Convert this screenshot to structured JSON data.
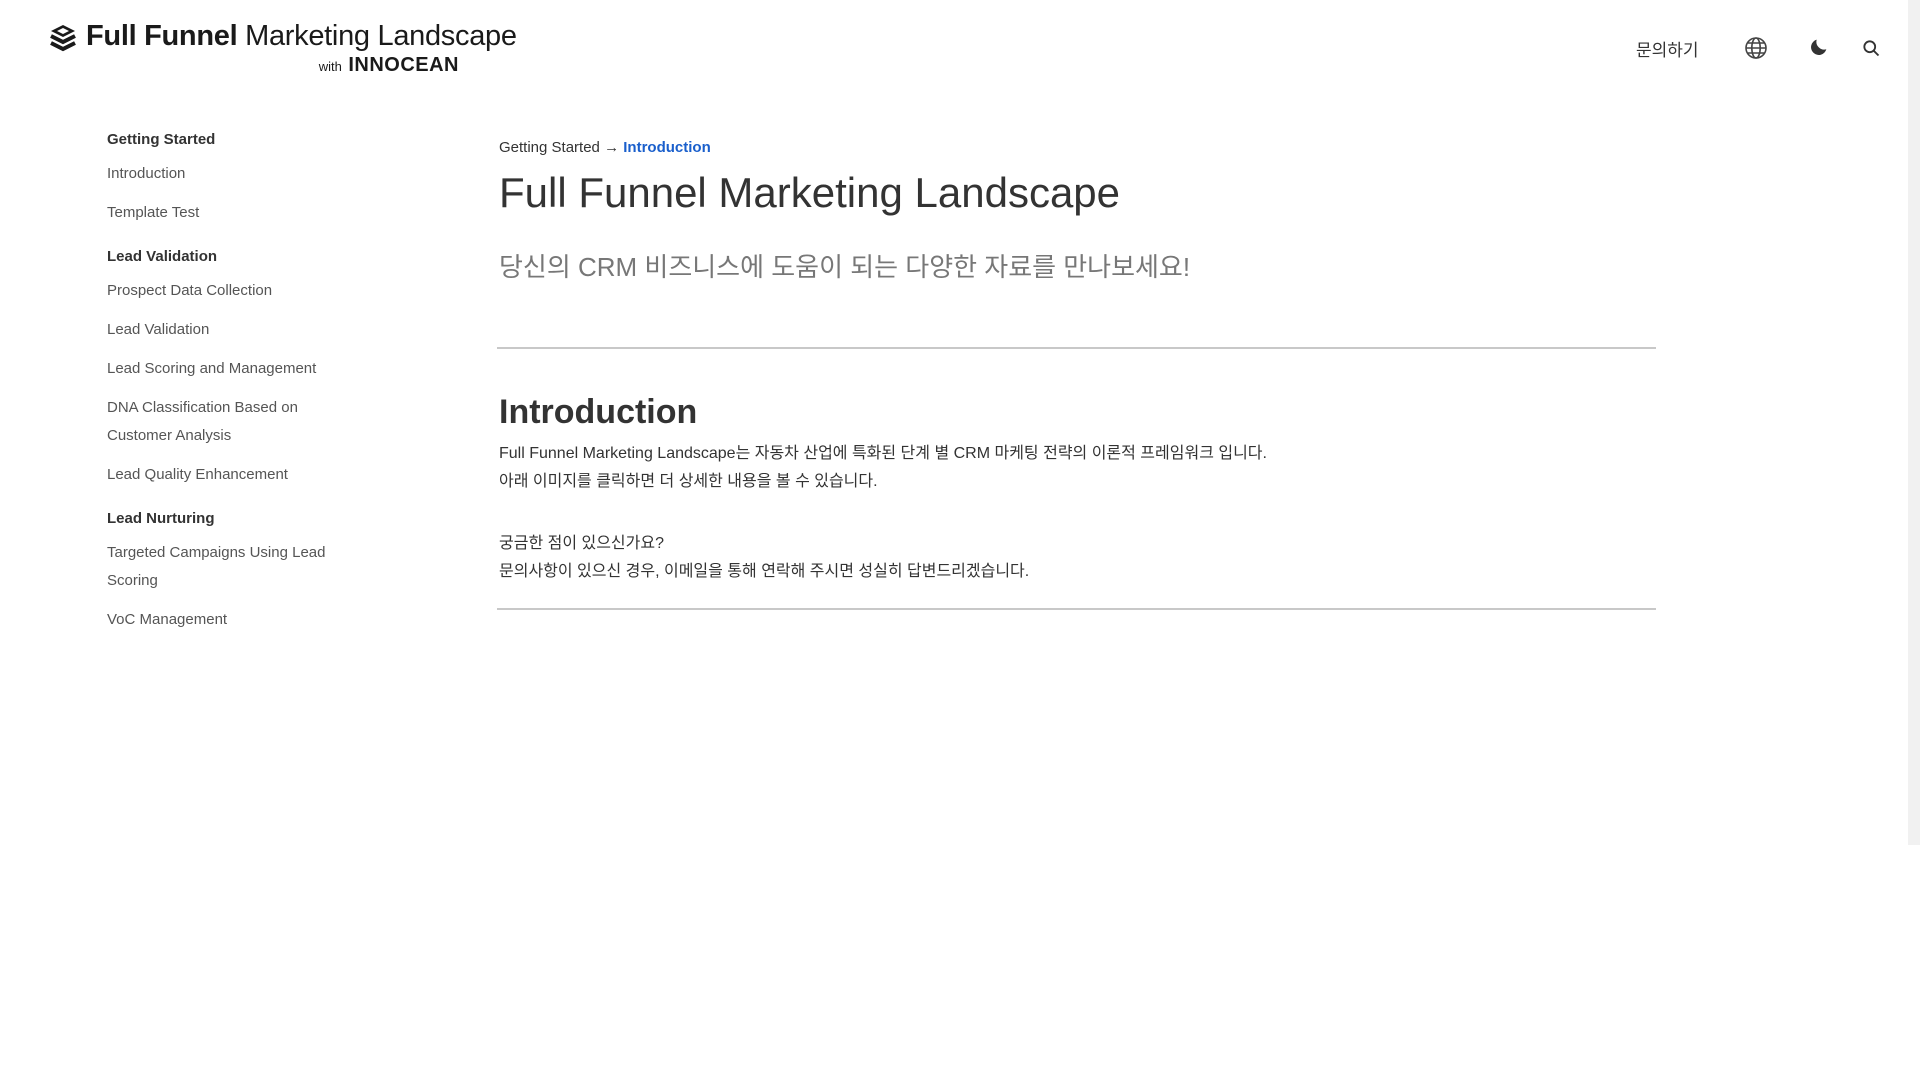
{
  "header": {
    "logo_icon": "stacked-layers-icon",
    "logo_title_bold": "Full Funnel",
    "logo_title_light": " Marketing Landscape",
    "logo_with": "with",
    "logo_brand": "INNOCEAN",
    "contact_label": "문의하기",
    "icons": [
      "globe-icon",
      "moon-icon",
      "search-icon"
    ]
  },
  "sidebar": {
    "groups": [
      {
        "title": "Getting Started",
        "items": [
          "Introduction",
          "Template Test"
        ]
      },
      {
        "title": "Lead Validation",
        "items": [
          "Prospect Data Collection",
          "Lead Validation",
          "Lead Scoring and Management",
          "DNA Classification Based on Customer Analysis",
          "Lead Quality Enhancement"
        ]
      },
      {
        "title": "Lead Nurturing",
        "items": [
          "Targeted Campaigns Using Lead Scoring",
          "VoC Management"
        ]
      }
    ]
  },
  "main": {
    "breadcrumb_parent": "Getting Started",
    "breadcrumb_sep": " → ",
    "breadcrumb_current": "Introduction",
    "title": "Full Funnel Marketing Landscape",
    "subtitle": "당신의 CRM 비즈니스에 도움이 되는 다양한 자료를 만나보세요!",
    "section_title": "Introduction",
    "para1_line1": "Full Funnel Marketing Landscape는 자동차 산업에 특화된 단계 별 CRM 마케팅 전략의 이론적 프레임워크 입니다.",
    "para1_line2": "아래 이미지를 클릭하면 더 상세한 내용을 볼 수 있습니다.",
    "para2_line1": "궁금한 점이 있으신가요?",
    "para2_line2": "문의사항이 있으신 경우, 이메일을 통해 연락해 주시면 성실히 답변드리겠습니다."
  },
  "colors": {
    "accent_link": "#1a5fcc",
    "text": "#333333",
    "muted": "#777777",
    "divider": "#c8c8c8"
  }
}
